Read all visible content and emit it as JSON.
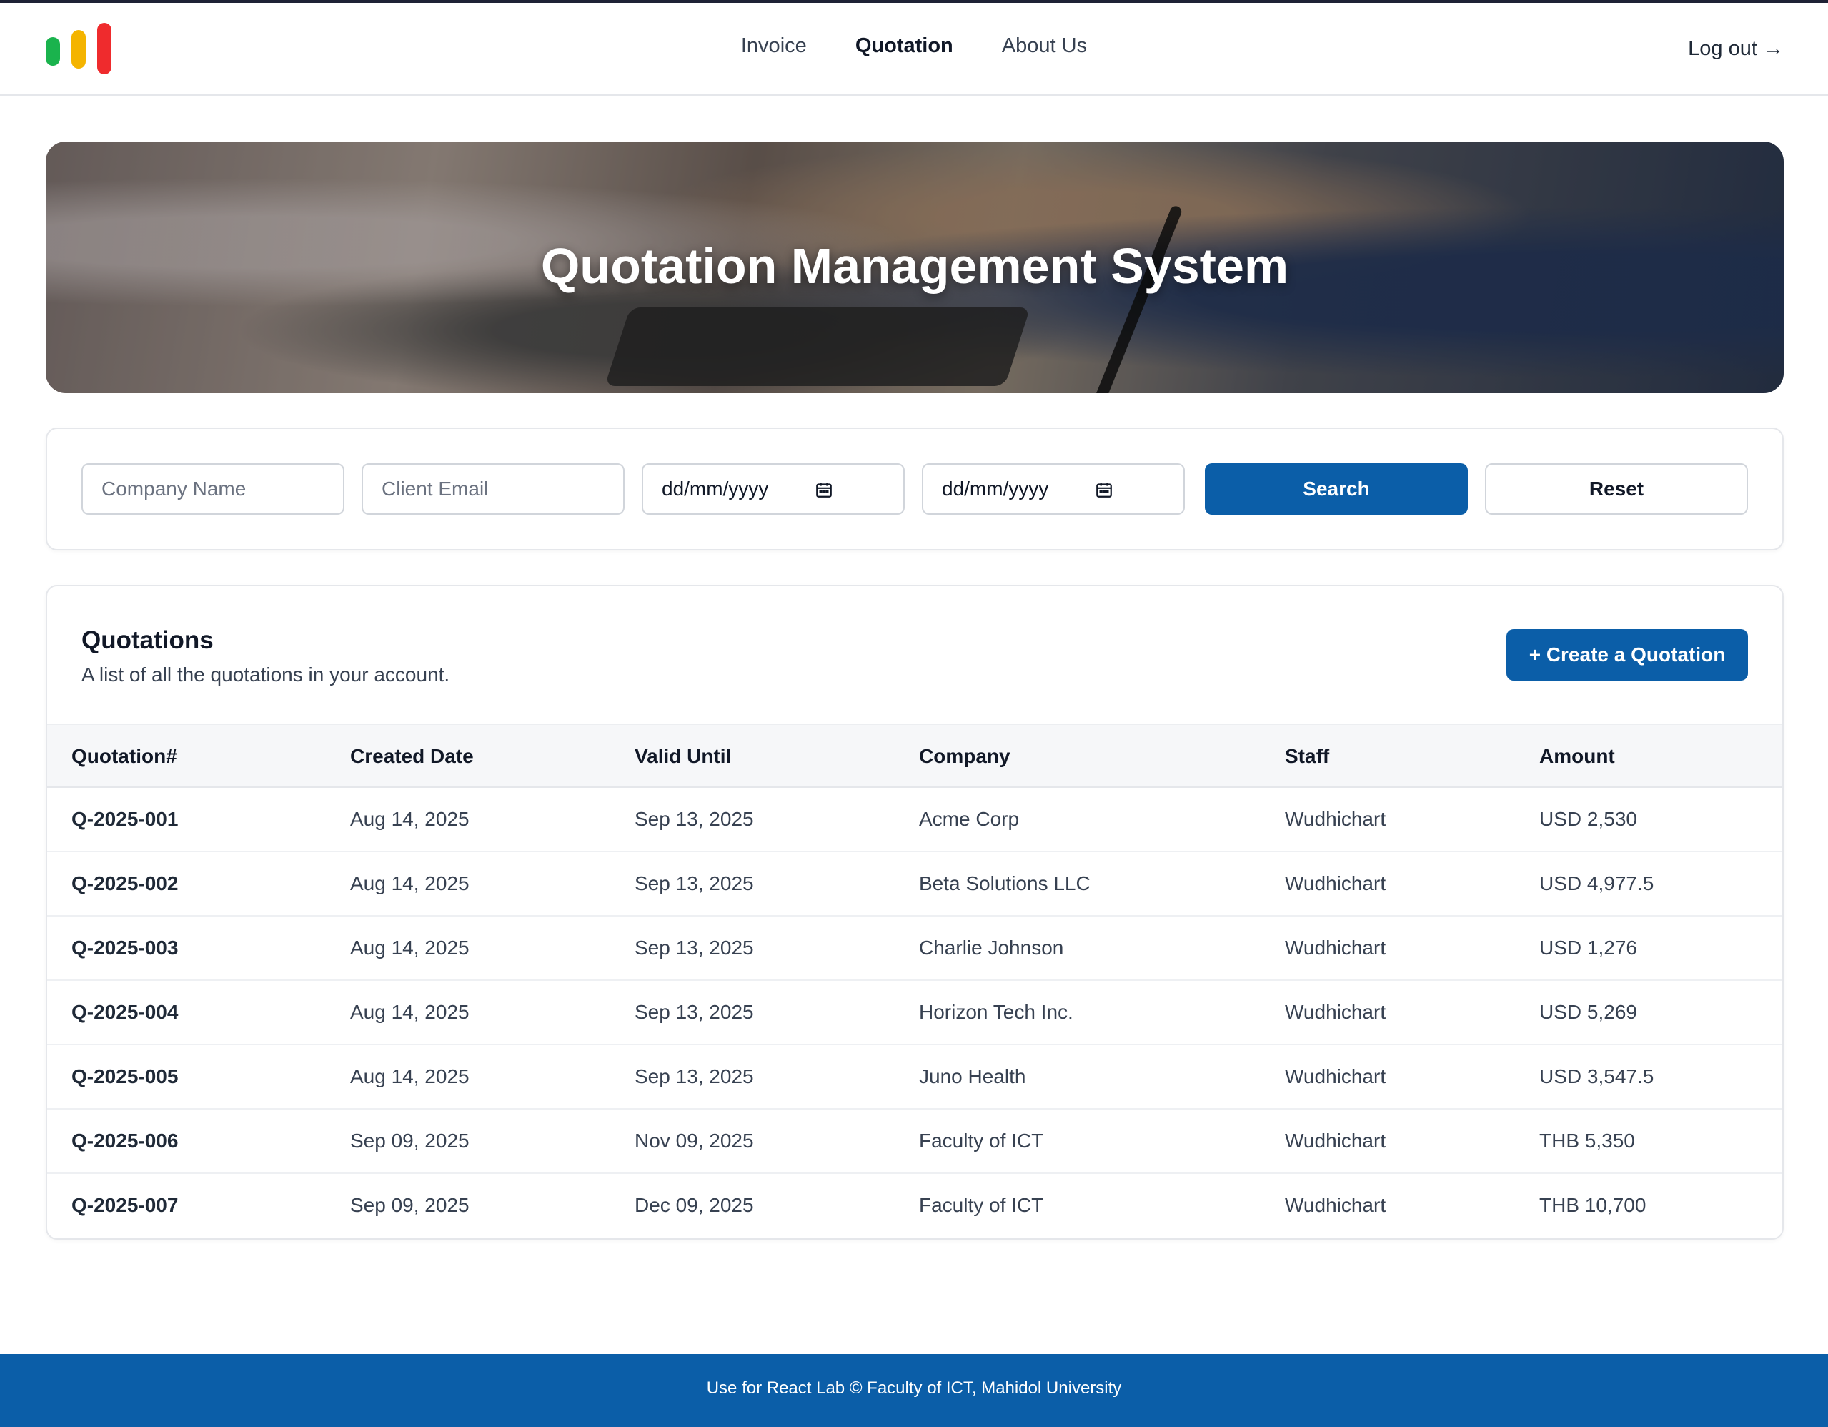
{
  "colors": {
    "primary": "#0b5ea8",
    "logo_green": "#1ab34d",
    "logo_yellow": "#f4b400",
    "logo_red": "#ef2b2d"
  },
  "nav": {
    "links": [
      "Invoice",
      "Quotation",
      "About Us"
    ],
    "active": "Quotation",
    "logout_label": "Log out →"
  },
  "hero": {
    "title": "Quotation Management System"
  },
  "search": {
    "company_placeholder": "Company Name",
    "email_placeholder": "Client Email",
    "date_from": "dd/mm/yyyy",
    "date_to": "dd/mm/yyyy",
    "search_label": "Search",
    "reset_label": "Reset"
  },
  "list": {
    "title": "Quotations",
    "subtitle": "A list of all the quotations in your account.",
    "create_label": "+ Create a Quotation",
    "columns": [
      "Quotation#",
      "Created Date",
      "Valid Until",
      "Company",
      "Staff",
      "Amount"
    ],
    "rows": [
      [
        "Q-2025-001",
        "Aug 14, 2025",
        "Sep 13, 2025",
        "Acme Corp",
        "Wudhichart",
        "USD 2,530"
      ],
      [
        "Q-2025-002",
        "Aug 14, 2025",
        "Sep 13, 2025",
        "Beta Solutions LLC",
        "Wudhichart",
        "USD 4,977.5"
      ],
      [
        "Q-2025-003",
        "Aug 14, 2025",
        "Sep 13, 2025",
        "Charlie Johnson",
        "Wudhichart",
        "USD 1,276"
      ],
      [
        "Q-2025-004",
        "Aug 14, 2025",
        "Sep 13, 2025",
        "Horizon Tech Inc.",
        "Wudhichart",
        "USD 5,269"
      ],
      [
        "Q-2025-005",
        "Aug 14, 2025",
        "Sep 13, 2025",
        "Juno Health",
        "Wudhichart",
        "USD 3,547.5"
      ],
      [
        "Q-2025-006",
        "Sep 09, 2025",
        "Nov 09, 2025",
        "Faculty of ICT",
        "Wudhichart",
        "THB 5,350"
      ],
      [
        "Q-2025-007",
        "Sep 09, 2025",
        "Dec 09, 2025",
        "Faculty of ICT",
        "Wudhichart",
        "THB 10,700"
      ]
    ]
  },
  "footer": {
    "text": "Use for React Lab © Faculty of ICT, Mahidol University"
  }
}
